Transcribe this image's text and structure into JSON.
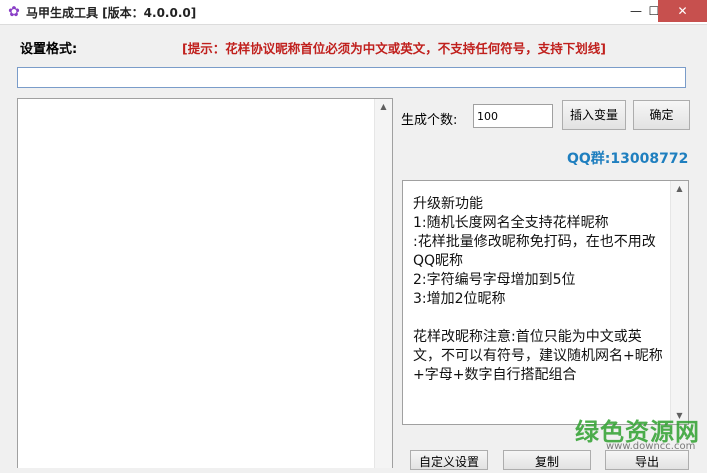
{
  "window": {
    "title": "马甲生成工具 [版本：4.0.0.0]",
    "minimize": "—",
    "maximize": "☐",
    "close": "✕"
  },
  "form": {
    "format_label": "设置格式:",
    "hint": "[提示：花样协议昵称首位必须为中文或英文，不支持任何符号，支持下划线]",
    "format_value": "",
    "count_label": "生成个数:",
    "count_value": "100",
    "insert_variable_label": "插入变量",
    "confirm_label": "确定",
    "qq_group": "QQ群:13008772"
  },
  "notes": {
    "text": "升级新功能\n1:随机长度网名全支持花样昵称\n:花样批量修改昵称免打码，在也不用改QQ昵称\n2:字符编号字母增加到5位\n3:增加2位昵称\n\n花样改昵称注意:首位只能为中文或英文，不可以有符号，建议随机网名+昵称+字母+数字自行搭配组合"
  },
  "bottom_buttons": {
    "custom_settings": "自定义设置",
    "copy": "复制",
    "export": "导出"
  },
  "watermark": {
    "text": "绿色资源网",
    "url": "www.downcc.com"
  },
  "colors": {
    "hint": "#c0201d",
    "qq": "#1f7fbf",
    "watermark": "#2fa12f"
  }
}
